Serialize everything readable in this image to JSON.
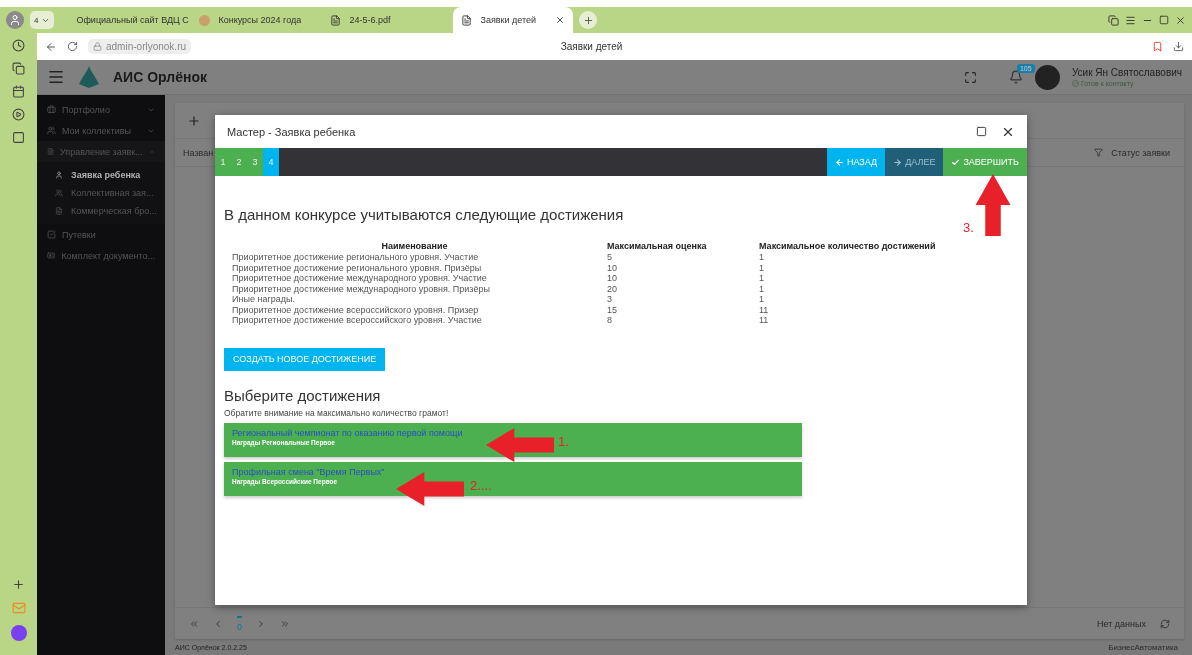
{
  "browser": {
    "tab_count": "4",
    "tabs": [
      {
        "title": "Официальный сайт ВДЦ С",
        "kind": "site",
        "selected": false
      },
      {
        "title": "Конкурсы 2024 года",
        "kind": "site",
        "selected": false
      },
      {
        "title": "24-5-6.pdf",
        "kind": "file",
        "selected": false
      },
      {
        "title": "Заявки детей",
        "kind": "file",
        "selected": true
      }
    ],
    "address": "admin-orlyonok.ru",
    "page_title": "Заявки детей"
  },
  "app": {
    "title": "АИС Орлёнок",
    "notifications": "105",
    "user": {
      "name": "Усик Ян Святославович",
      "status": "Готов к контакту"
    },
    "sidebar": [
      {
        "label": "Портфолио",
        "expanded": false
      },
      {
        "label": "Мои коллективы",
        "expanded": false
      },
      {
        "label": "Управление заявк...",
        "expanded": true,
        "children": [
          {
            "label": "Заявка ребенка",
            "selected": true
          },
          {
            "label": "Коллективная зая...",
            "selected": false
          },
          {
            "label": "Коммерческая бро...",
            "selected": false
          }
        ]
      },
      {
        "label": "Путевки"
      },
      {
        "label": "Комплект документо..."
      }
    ],
    "table": {
      "columns": [
        "Назван",
        "Статус заявки"
      ],
      "pager": {
        "page": "0",
        "status": "Нет данных"
      }
    },
    "footer": {
      "version": "АИС Орлёнок 2.0.2.25",
      "vendor": "БизнесАвтоматика"
    }
  },
  "dialog": {
    "title": "Мастер - Заявка ребенка",
    "steps": [
      {
        "label": "1",
        "selected": false
      },
      {
        "label": "2",
        "selected": false
      },
      {
        "label": "3",
        "selected": false
      },
      {
        "label": "4",
        "selected": true
      }
    ],
    "buttons": [
      {
        "label": "НАЗАД",
        "kind": "back",
        "disabled": false
      },
      {
        "label": "ДАЛЕЕ",
        "kind": "next",
        "disabled": true
      },
      {
        "label": "ЗАВЕРШИТЬ",
        "kind": "finish",
        "disabled": false
      }
    ],
    "heading": "В данном конкурсе учитываются следующие достижения",
    "table": {
      "columns": [
        "Наименование",
        "Максимальная оценка",
        "Максимальное количество достижений"
      ],
      "rows": [
        [
          "Приоритетное достижение регионального уровня. Участие",
          "5",
          "1"
        ],
        [
          "Приоритетное достижение регионального уровня. Призёры",
          "10",
          "1"
        ],
        [
          "Приоритетное достижение международного уровня. Участие",
          "10",
          "1"
        ],
        [
          "Приоритетное достижение международного уровня. Призёры",
          "20",
          "1"
        ],
        [
          "Иные награды.",
          "3",
          "1"
        ],
        [
          "Приоритетное достижение всероссийского уровня. Призер",
          "15",
          "11"
        ],
        [
          "Приоритетное достижение всероссийского уровня. Участие",
          "8",
          "11"
        ]
      ]
    },
    "create_button": "СОЗДАТЬ НОВОЕ ДОСТИЖЕНИЕ",
    "select_heading": "Выберите достижения",
    "note": "Обратите внимание на максимально количество грамот!",
    "achievements": [
      {
        "title": "Региональный чемпионат по оказанию первой помощи",
        "subtitle": "Награды Региональные Первое"
      },
      {
        "title": "Профильная смена \"Время Первых\"",
        "subtitle": "Награды Всероссийские Первое"
      }
    ],
    "annotations": [
      {
        "label": "1.",
        "kind": "left"
      },
      {
        "label": "2....",
        "kind": "left"
      },
      {
        "label": "3.",
        "kind": "up"
      }
    ]
  }
}
